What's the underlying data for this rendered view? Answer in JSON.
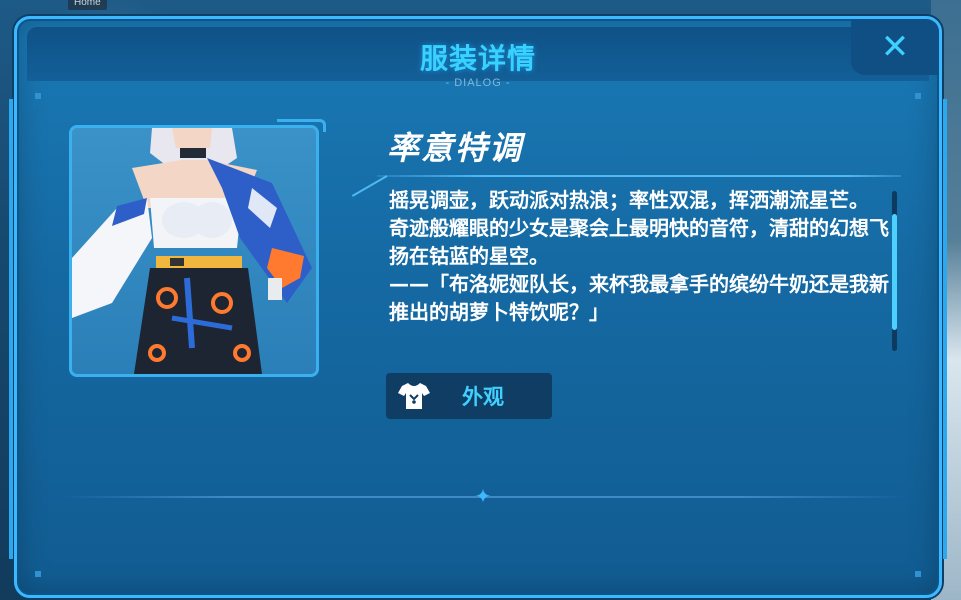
{
  "background": {
    "home_tag": "Home"
  },
  "dialog": {
    "title": "服装详情",
    "subtitle": "- DIALOG -",
    "close_icon": "close-x",
    "outfit_name": "率意特调",
    "description": [
      "摇晃调壶，跃动派对热浪；率性双混，挥洒潮流星芒。",
      "奇迹般耀眼的少女是聚会上最明快的音符，清甜的幻想飞扬在钴蓝的星空。",
      "——「布洛妮娅队长，来杯我最拿手的缤纷牛奶还是我新推出的胡萝卜特饮呢？」"
    ],
    "appearance_button": {
      "icon": "shirt-icon",
      "label": "外观"
    }
  },
  "colors": {
    "accent": "#3db8ff",
    "title": "#37d2ff",
    "panel": "#1569a2",
    "button_bg": "#0f3d63"
  }
}
